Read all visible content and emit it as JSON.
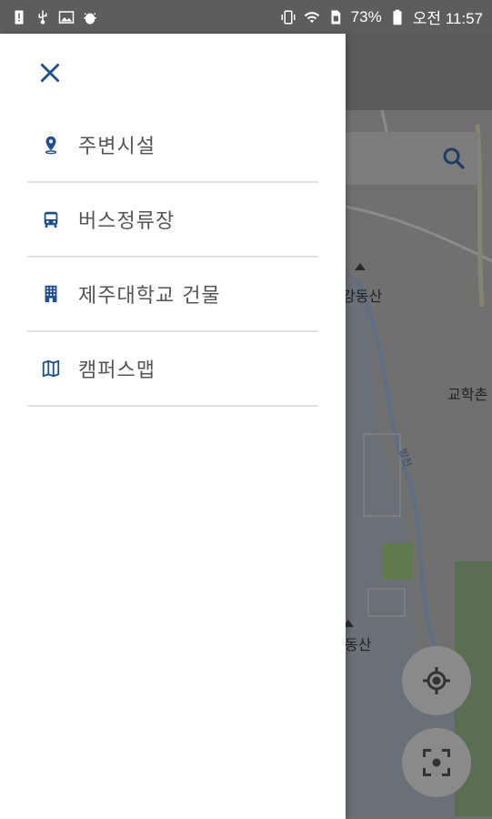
{
  "status_bar": {
    "battery_percent": "73%",
    "time": "오전 11:57",
    "left_icons": [
      "alert-icon",
      "usb-icon",
      "image-icon",
      "android-debug-icon"
    ],
    "right_icons": [
      "vibrate-icon",
      "wifi-icon",
      "sim-icon",
      "battery-icon"
    ]
  },
  "drawer": {
    "accent_color": "#1f4f8f",
    "items": [
      {
        "label": "주변시설",
        "icon": "location-pin-icon"
      },
      {
        "label": "버스정류장",
        "icon": "bus-icon"
      },
      {
        "label": "제주대학교 건물",
        "icon": "building-icon"
      },
      {
        "label": "캠퍼스맵",
        "icon": "map-icon"
      }
    ]
  },
  "map": {
    "labels": {
      "mountain_1": "강동산",
      "village": "교학촌",
      "stream": "방천",
      "mountain_2": "동산"
    }
  }
}
